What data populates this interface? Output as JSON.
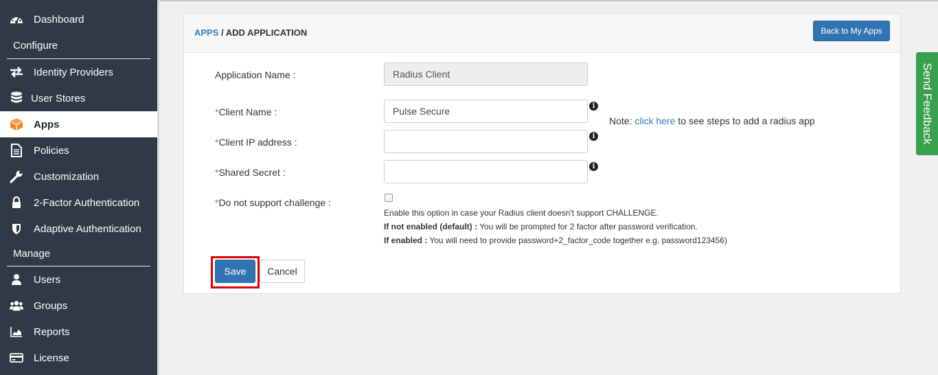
{
  "sidebar": {
    "items": [
      {
        "label": "Dashboard",
        "icon": "dashboard-icon"
      },
      {
        "label": "Identity Providers",
        "icon": "arrows-exchange-icon"
      },
      {
        "label": "User Stores",
        "icon": "database-icon"
      },
      {
        "label": "Apps",
        "icon": "cube-icon",
        "active": true
      },
      {
        "label": "Policies",
        "icon": "document-icon"
      },
      {
        "label": "Customization",
        "icon": "wrench-icon"
      },
      {
        "label": "2-Factor Authentication",
        "icon": "lock-icon"
      },
      {
        "label": "Adaptive Authentication",
        "icon": "shield-icon"
      },
      {
        "label": "Users",
        "icon": "user-icon"
      },
      {
        "label": "Groups",
        "icon": "group-icon"
      },
      {
        "label": "Reports",
        "icon": "area-chart-icon"
      },
      {
        "label": "License",
        "icon": "credit-card-icon"
      }
    ],
    "sections": {
      "configure": "Configure",
      "manage": "Manage"
    }
  },
  "header": {
    "breadcrumb_link": "APPS",
    "breadcrumb_sep": " / ",
    "breadcrumb_current": "ADD APPLICATION",
    "back_button": "Back to My Apps"
  },
  "form": {
    "app_name": {
      "label": "Application Name :",
      "value": "Radius Client"
    },
    "client_name": {
      "label": "Client Name :",
      "value": "Pulse Secure"
    },
    "client_ip": {
      "label": "Client IP address :",
      "value": ""
    },
    "shared_secret": {
      "label": "Shared Secret :",
      "value": ""
    },
    "challenge": {
      "label": "Do not support challenge :",
      "checked": false
    },
    "required_mark": "*"
  },
  "note": {
    "prefix": "Note: ",
    "link": "click here",
    "suffix": " to see steps to add a radius app"
  },
  "help": {
    "line1": "Enable this option in case your Radius client doesn't support CHALLENGE.",
    "line2_bold": "If not enabled (default) :",
    "line2_rest": " You will be prompted for 2 factor after password verification.",
    "line3_bold": "If enabled :",
    "line3_rest": " You will need to provide password+2_factor_code together e.g. password123456)"
  },
  "buttons": {
    "save": "Save",
    "cancel": "Cancel"
  },
  "feedback": {
    "label": "Send Feedback"
  },
  "colors": {
    "sidebar": "#2f3a46",
    "primary": "#3174b3",
    "link": "#2f7ec2",
    "feedback": "#3aa04b",
    "highlight": "#e00000"
  }
}
